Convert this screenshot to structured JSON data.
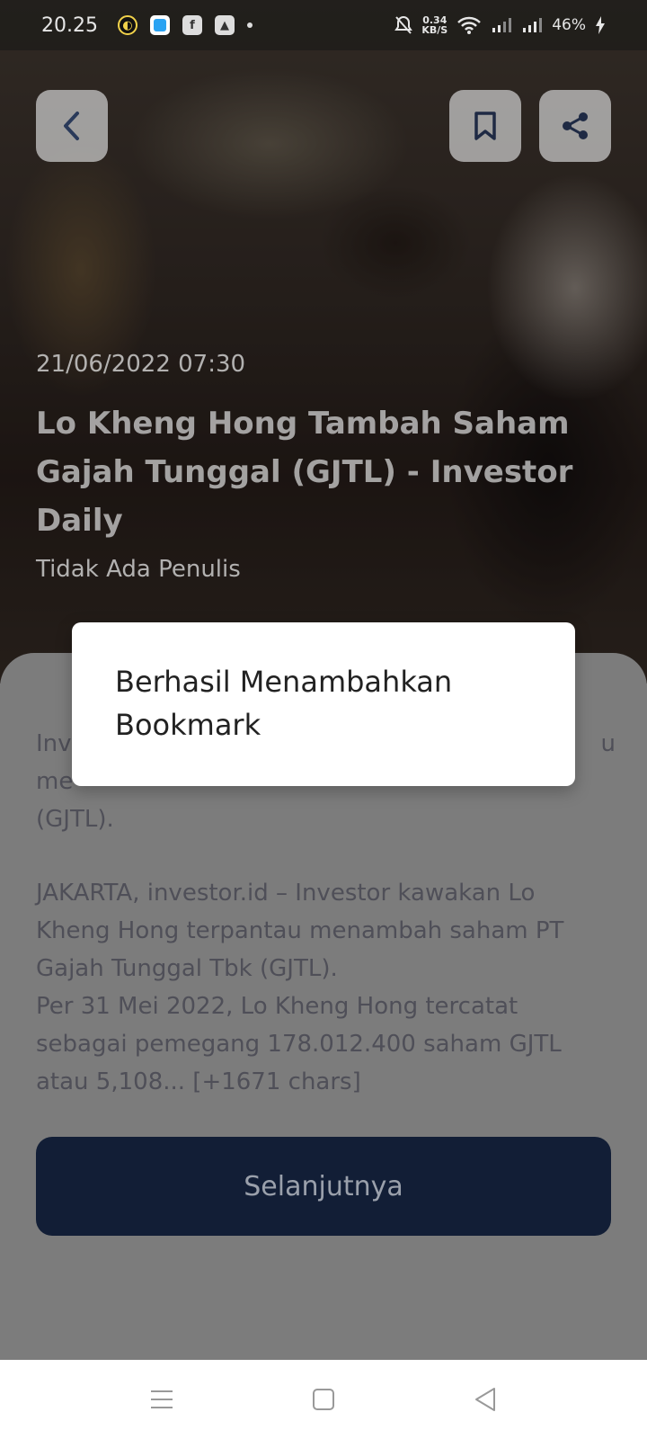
{
  "status_bar": {
    "time": "20.25",
    "speed_value": "0.34",
    "speed_unit": "KB/S",
    "battery": "46%"
  },
  "header": {
    "back_icon": "chevron-left-icon",
    "bookmark_icon": "bookmark-icon",
    "share_icon": "share-icon"
  },
  "article": {
    "date": "21/06/2022 07:30",
    "title": "Lo Kheng Hong Tambah Saham Gajah Tunggal (GJTL) - Investor Daily",
    "author": "Tidak Ada Penulis",
    "summary_line_1": "Inv",
    "summary_line_1_end": "u",
    "summary_line_2": "me",
    "summary_line_3": "(GJTL).",
    "body_1": "JAKARTA, investor.id – Investor kawakan Lo Kheng Hong terpantau menambah saham PT Gajah Tunggal Tbk (GJTL).",
    "body_2": "Per 31 Mei 2022, Lo Kheng Hong tercatat sebagai pemegang 178.012.400 saham GJTL atau 5,108... [+1671 chars]",
    "next_label": "Selanjutnya"
  },
  "toast": {
    "message": "Berhasil Menambahkan Bookmark"
  },
  "colors": {
    "primary_button": "#121e36",
    "toast_bg": "#ffffff"
  }
}
